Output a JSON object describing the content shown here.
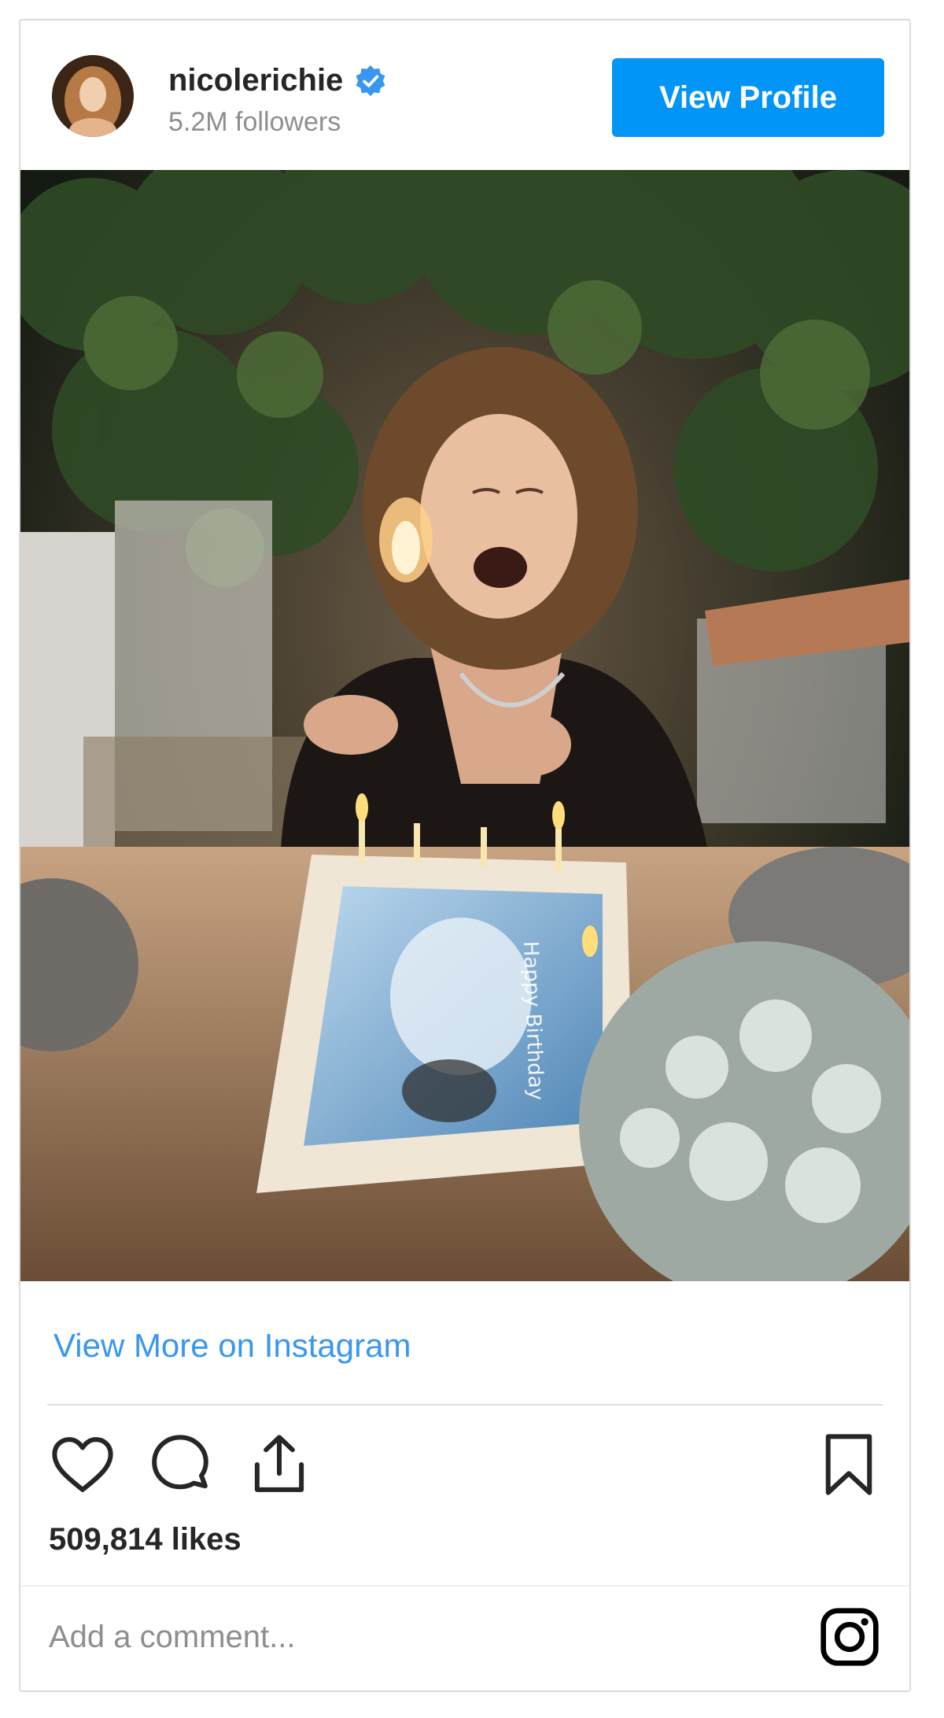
{
  "header": {
    "username": "nicolerichie",
    "verified_icon": "verified-badge-icon",
    "followers": "5.2M followers",
    "view_profile_label": "View Profile"
  },
  "post": {
    "image_icon": "post-photo",
    "view_more_label": "View More on Instagram",
    "likes": "509,814 likes"
  },
  "actions": {
    "like_icon": "heart-icon",
    "comment_icon": "comment-icon",
    "share_icon": "share-icon",
    "save_icon": "bookmark-icon"
  },
  "comment": {
    "placeholder": "Add a comment..."
  },
  "footer": {
    "logo_icon": "instagram-icon"
  },
  "colors": {
    "accent": "#0095f6",
    "link": "#3897f0",
    "text": "#262626",
    "muted": "#8e8e8e",
    "border": "#dbdbdb"
  }
}
